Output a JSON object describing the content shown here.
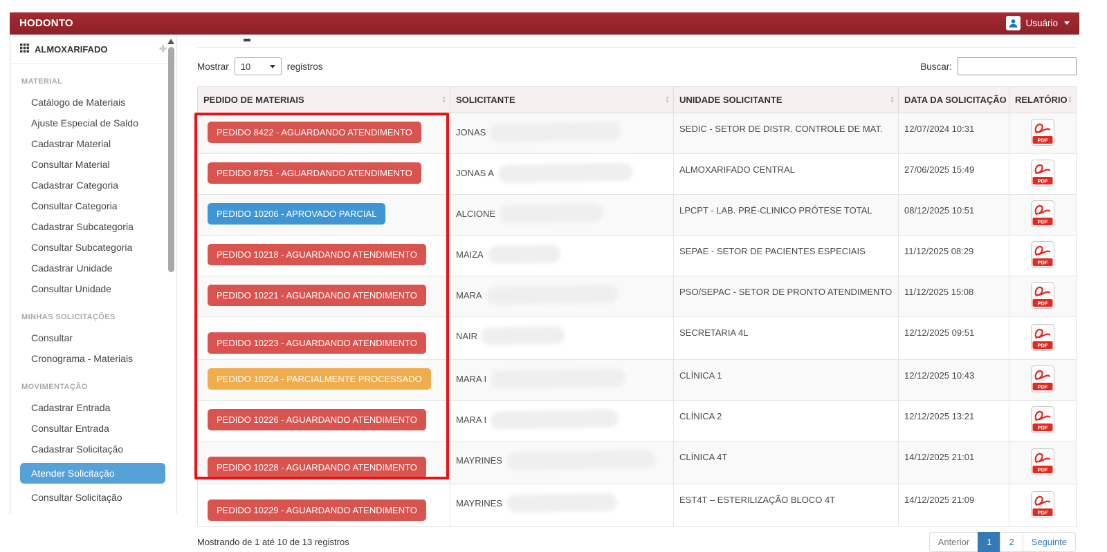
{
  "navbar": {
    "brand": "HODONTO",
    "user_label": "Usuário"
  },
  "sidebar": {
    "panel_title": "ALMOXARIFADO",
    "active_item": "Atender Solicitação",
    "sections": [
      {
        "label": "MATERIAL",
        "items": [
          "Catálogo de Materiais",
          "Ajuste Especial de Saldo",
          "Cadastrar Material",
          "Consultar Material",
          "Cadastrar Categoria",
          "Consultar Categoria",
          "Cadastrar Subcategoria",
          "Consultar Subcategoria",
          "Cadastrar Unidade",
          "Consultar Unidade"
        ]
      },
      {
        "label": "MINHAS SOLICITAÇÕES",
        "items": [
          "Consultar",
          "Cronograma - Materiais"
        ]
      },
      {
        "label": "MOVIMENTAÇÃO",
        "items": [
          "Cadastrar Entrada",
          "Consultar Entrada",
          "Cadastrar Solicitação",
          "Atender Solicitação",
          "Consultar Solicitação"
        ]
      }
    ]
  },
  "toolbar": {
    "show_label": "Mostrar",
    "page_size_value": "10",
    "records_label": "registros",
    "search_label": "Buscar:",
    "search_value": ""
  },
  "table": {
    "columns": [
      "PEDIDO DE MATERIAIS",
      "SOLICITANTE",
      "UNIDADE SOLICITANTE",
      "DATA DA SOLICITAÇÃO",
      "RELATÓRIO"
    ],
    "pdf_label": "PDF",
    "rows": [
      {
        "pedido_label": "PEDIDO 8422 - AGUARDANDO ATENDIMENTO",
        "status": "danger",
        "solicitante": "JONAS",
        "unidade": "SEDIC - SETOR DE DISTR. CONTROLE DE MAT.",
        "data": "12/07/2024 10:31"
      },
      {
        "pedido_label": "PEDIDO 8751 - AGUARDANDO ATENDIMENTO",
        "status": "danger",
        "solicitante": "JONAS A",
        "unidade": "ALMOXARIFADO CENTRAL",
        "data": "27/06/2025 15:49"
      },
      {
        "pedido_label": "PEDIDO 10206 - APROVADO PARCIAL",
        "status": "primary",
        "solicitante": "ALCIONE",
        "unidade": "LPCPT - LAB. PRÉ-CLINICO PRÓTESE TOTAL",
        "data": "08/12/2025 10:51"
      },
      {
        "pedido_label": "PEDIDO 10218 - AGUARDANDO ATENDIMENTO",
        "status": "danger",
        "solicitante": "MAIZA",
        "unidade": "SEPAE - SETOR DE PACIENTES ESPECIAIS",
        "data": "11/12/2025 08:29"
      },
      {
        "pedido_label": "PEDIDO 10221 - AGUARDANDO ATENDIMENTO",
        "status": "danger",
        "solicitante": "MARA",
        "unidade": "PSO/SEPAC - SETOR DE PRONTO ATENDIMENTO",
        "data": "11/12/2025 15:08"
      },
      {
        "pedido_label": "PEDIDO 10223 - AGUARDANDO ATENDIMENTO",
        "status": "danger",
        "solicitante": "NAIR",
        "unidade": "SECRETARIA 4L",
        "data": "12/12/2025 09:51"
      },
      {
        "pedido_label": "PEDIDO 10224 - PARCIALMENTE PROCESSADO",
        "status": "warning",
        "solicitante": "MARA I",
        "unidade": "CLÍNICA 1",
        "data": "12/12/2025 10:43"
      },
      {
        "pedido_label": "PEDIDO 10226 - AGUARDANDO ATENDIMENTO",
        "status": "danger",
        "solicitante": "MARA I",
        "unidade": "CLÍNICA 2",
        "data": "12/12/2025 13:21"
      },
      {
        "pedido_label": "PEDIDO 10228 - AGUARDANDO ATENDIMENTO",
        "status": "danger",
        "solicitante": "MAYRINES",
        "unidade": "CLÍNICA 4T",
        "data": "14/12/2025 21:01"
      },
      {
        "pedido_label": "PEDIDO 10229 - AGUARDANDO ATENDIMENTO",
        "status": "danger",
        "solicitante": "MAYRINES",
        "unidade": "EST4T – ESTERILIZAÇÃO BLOCO 4T",
        "data": "14/12/2025 21:09"
      }
    ]
  },
  "footer": {
    "info": "Mostrando de 1 até 10 de 13 registros",
    "pagination": {
      "prev_label": "Anterior",
      "pages": [
        "1",
        "2"
      ],
      "active_page": "1",
      "next_label": "Seguinte"
    }
  },
  "colors": {
    "navbar_red": "#9a262c",
    "status_danger": "#d9534f",
    "status_primary": "#3f96d4",
    "status_warning": "#f0ad4e",
    "sidebar_active": "#55a1d8",
    "pagination_active": "#337ab7",
    "annotation_red": "#ee1111",
    "header_bg": "#f7f0f1"
  }
}
